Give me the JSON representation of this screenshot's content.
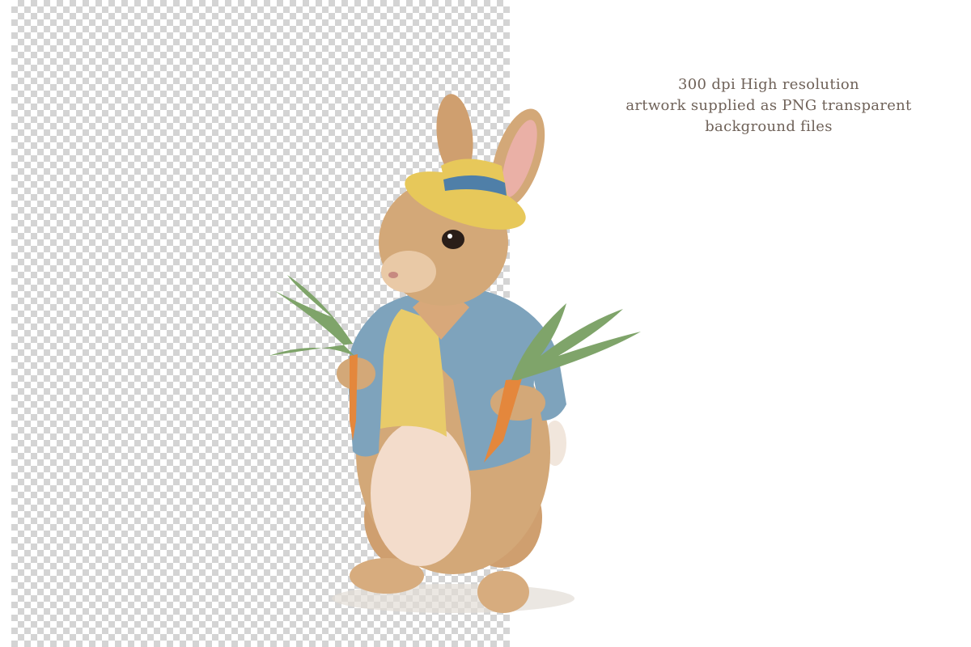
{
  "caption": {
    "line1": "300 dpi High resolution",
    "line2": "artwork supplied as PNG transparent",
    "line3": "background files"
  },
  "illustration": {
    "subject": "rabbit-in-jacket-holding-carrots",
    "colors": {
      "fur": "#d3a878",
      "belly": "#f3dccb",
      "jacket": "#7ea3bc",
      "vest": "#e8cb6a",
      "hat": "#e7c85a",
      "hat_band": "#4f7fa8",
      "carrot": "#e4873c",
      "leaves": "#7fa46a",
      "checker_dark": "#d4d4d4"
    }
  }
}
